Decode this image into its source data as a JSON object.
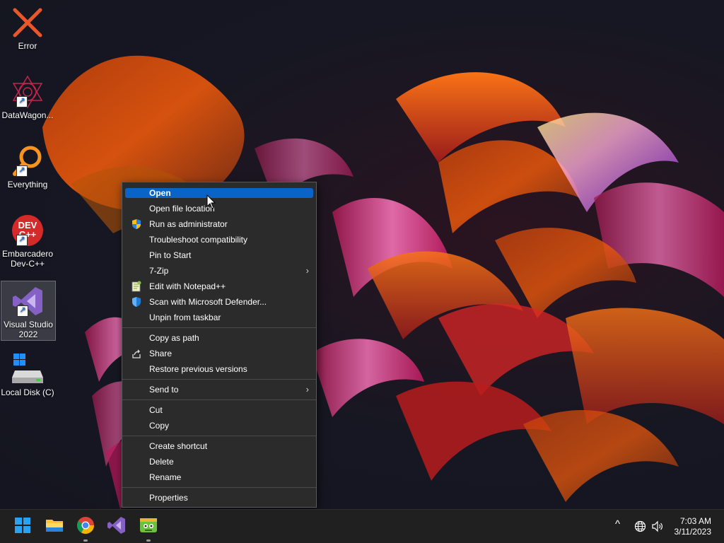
{
  "desktop": {
    "icons": [
      {
        "label": "Error",
        "icon": "error-x-icon",
        "shortcut": false
      },
      {
        "label": "DataWagon...",
        "icon": "datawagon-icon",
        "shortcut": true
      },
      {
        "label": "Everything",
        "icon": "everything-search-icon",
        "shortcut": true
      },
      {
        "label": "Embarcadero Dev-C++",
        "icon": "devcpp-icon",
        "shortcut": true,
        "glyph_text": "DEV C++"
      },
      {
        "label": "Visual Studio 2022",
        "icon": "visual-studio-icon",
        "shortcut": true,
        "selected": true
      },
      {
        "label": "Local Disk (C)",
        "icon": "local-disk-icon",
        "shortcut": false
      }
    ]
  },
  "context_menu": {
    "items": [
      {
        "label": "Open",
        "highlighted": true
      },
      {
        "label": "Open file location"
      },
      {
        "label": "Run as administrator",
        "icon": "uac-shield-icon"
      },
      {
        "label": "Troubleshoot compatibility"
      },
      {
        "label": "Pin to Start"
      },
      {
        "label": "7-Zip",
        "submenu": true
      },
      {
        "label": "Edit with Notepad++",
        "icon": "notepadpp-icon"
      },
      {
        "label": "Scan with Microsoft Defender...",
        "icon": "defender-icon"
      },
      {
        "label": "Unpin from taskbar"
      },
      {
        "label": "Copy as path"
      },
      {
        "label": "Share",
        "icon": "share-icon"
      },
      {
        "label": "Restore previous versions"
      },
      {
        "label": "Send to",
        "submenu": true
      },
      {
        "label": "Cut"
      },
      {
        "label": "Copy"
      },
      {
        "label": "Create shortcut"
      },
      {
        "label": "Delete"
      },
      {
        "label": "Rename"
      },
      {
        "label": "Properties"
      }
    ],
    "submenu_chevron": "›"
  },
  "taskbar": {
    "apps": [
      {
        "name": "start-button",
        "icon": "windows-logo-icon"
      },
      {
        "name": "file-explorer",
        "icon": "folder-icon"
      },
      {
        "name": "chrome",
        "icon": "chrome-icon",
        "running": true
      },
      {
        "name": "visual-studio",
        "icon": "visual-studio-icon"
      },
      {
        "name": "app-green",
        "icon": "green-app-icon",
        "running": true
      }
    ],
    "tray": {
      "chevron": "^",
      "network_icon": "globe-icon",
      "volume_icon": "speaker-icon"
    },
    "clock": {
      "time": "7:03 AM",
      "date": "3/11/2023"
    }
  },
  "colors": {
    "menu_bg": "#2b2b2b",
    "highlight": "#0a64c8",
    "taskbar_bg": "#202020",
    "error_orange": "#e8562a"
  }
}
